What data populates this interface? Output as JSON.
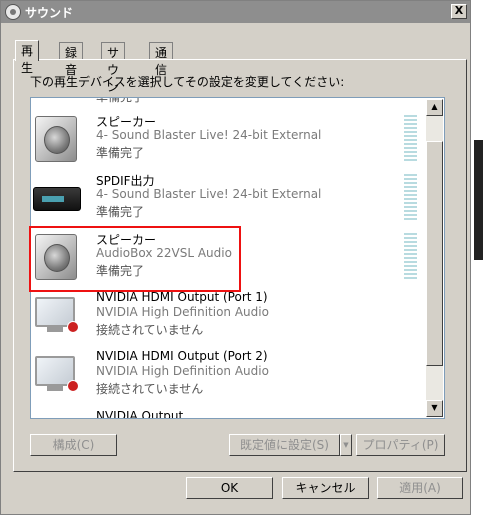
{
  "window": {
    "title": "サウンド",
    "close_label": "X"
  },
  "tabs": [
    {
      "label": "再生",
      "active": true
    },
    {
      "label": "録音",
      "active": false
    },
    {
      "label": "サウンド",
      "active": false
    },
    {
      "label": "通信",
      "active": false
    }
  ],
  "instruction": "下の再生デバイスを選択してその設定を変更してください:",
  "devices": {
    "partial_top": {
      "name": "準備完了"
    },
    "items": [
      {
        "icon": "speaker-icon",
        "name": "スピーカー",
        "detail": "4- Sound Blaster Live! 24-bit External",
        "status": "準備完了"
      },
      {
        "icon": "spdif-device-icon",
        "name": "SPDIF出力",
        "detail": "4- Sound Blaster Live! 24-bit External",
        "status": "準備完了"
      },
      {
        "icon": "speaker-icon",
        "name": "スピーカー",
        "detail": "AudioBox 22VSL Audio",
        "status": "準備完了"
      },
      {
        "icon": "monitor-icon",
        "name": "NVIDIA HDMI Output (Port 1)",
        "detail": "NVIDIA High Definition Audio",
        "status": "接続されていません"
      },
      {
        "icon": "monitor-icon",
        "name": "NVIDIA HDMI Output (Port 2)",
        "detail": "NVIDIA High Definition Audio",
        "status": "接続されていません"
      }
    ],
    "partial_bottom": {
      "name": "NVIDIA Output"
    }
  },
  "buttons": {
    "configure": "構成(C)",
    "set_default": "既定値に設定(S)",
    "properties": "プロパティ(P)",
    "ok": "OK",
    "cancel": "キャンセル",
    "apply": "適用(A)"
  },
  "colors": {
    "highlight": "#ee1111",
    "meter": "#b8dbe0"
  }
}
